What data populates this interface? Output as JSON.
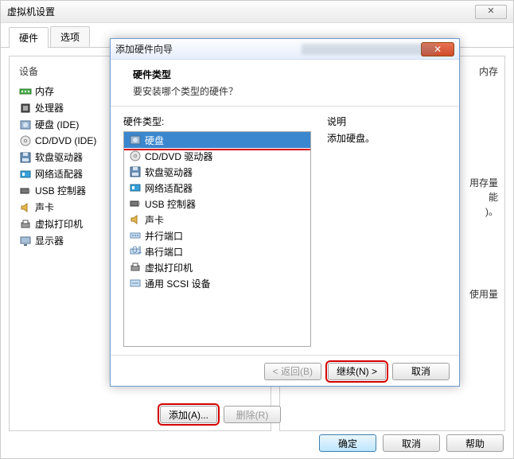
{
  "outer": {
    "title": "虚拟机设置",
    "close_glyph": "✕",
    "tabs": {
      "hw": "硬件",
      "opts": "选项"
    },
    "col_device": "设备",
    "devices": {
      "mem": "内存",
      "cpu": "处理器",
      "hdd": "硬盘 (IDE)",
      "cd": "CD/DVD (IDE)",
      "floppy": "软盘驱动器",
      "nic": "网络适配器",
      "usb": "USB 控制器",
      "sound": "声卡",
      "vprint": "虚拟打印机",
      "disp": "显示器"
    },
    "right_fragments": {
      "r0": "内存",
      "r1": "用存量",
      "r2": "能",
      "r3": ")。",
      "r4": "使用量"
    },
    "add_btn": "添加(A)...",
    "remove_btn": "删除(R)",
    "ok_btn": "确定",
    "cancel_btn": "取消",
    "help_btn": "帮助"
  },
  "wizard": {
    "title": "添加硬件向导",
    "close_glyph": "✕",
    "header_title": "硬件类型",
    "header_sub": "要安装哪个类型的硬件？",
    "list_label": "硬件类型:",
    "items": {
      "hdd": "硬盘",
      "cd": "CD/DVD 驱动器",
      "floppy": "软盘驱动器",
      "nic": "网络适配器",
      "usb": "USB 控制器",
      "sound": "声卡",
      "para": "并行端口",
      "serial": "串行端口",
      "vprint": "虚拟打印机",
      "scsi": "通用 SCSI 设备"
    },
    "right_title": "说明",
    "right_desc": "添加硬盘。",
    "back_btn": "< 返回(B)",
    "next_btn": "继续(N) >",
    "cancel_btn": "取消"
  },
  "colors": {
    "accent": "#3a87cf",
    "red": "#d40000"
  }
}
